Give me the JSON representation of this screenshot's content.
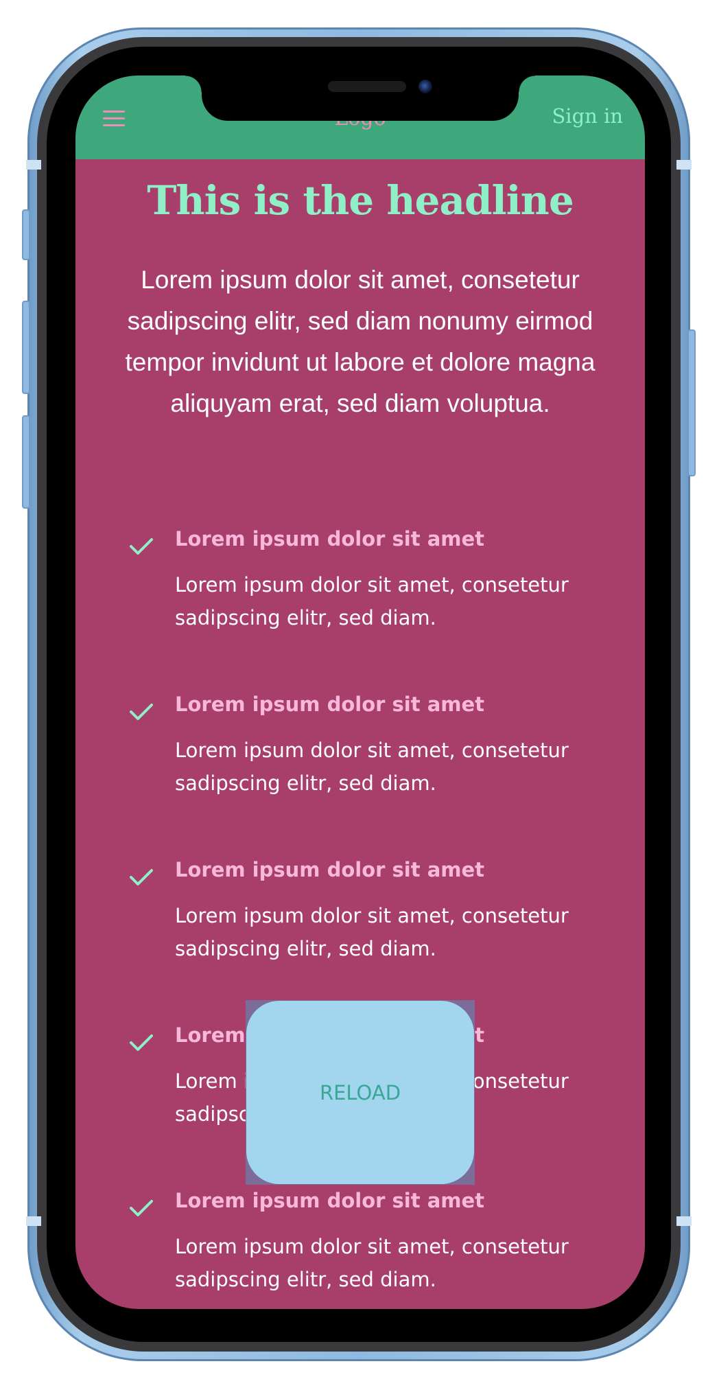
{
  "header": {
    "logo": "Logo",
    "sign_in": "Sign in"
  },
  "hero": {
    "headline": "This is the headline",
    "intro": "Lorem ipsum dolor sit amet, consetetur sadipscing elitr, sed diam nonumy eirmod tempor invidunt ut labore et dolore magna aliquyam erat, sed diam voluptua."
  },
  "features": [
    {
      "title": "Lorem ipsum dolor sit amet",
      "text": "Lorem ipsum dolor sit amet, consetetur sadipscing elitr, sed diam."
    },
    {
      "title": "Lorem ipsum dolor sit amet",
      "text": "Lorem ipsum dolor sit amet, consetetur sadipscing elitr, sed diam."
    },
    {
      "title": "Lorem ipsum dolor sit amet",
      "text": "Lorem ipsum dolor sit amet, consetetur sadipscing elitr, sed diam."
    },
    {
      "title": "Lorem ipsum dolor sit amet",
      "text": "Lorem ipsum dolor sit amet, consetetur sadipscing elitr, sed diam."
    },
    {
      "title": "Lorem ipsum dolor sit amet",
      "text": "Lorem ipsum dolor sit amet, consetetur sadipscing elitr, sed diam."
    }
  ],
  "overlay": {
    "reload_label": "RELOAD"
  },
  "icons": {
    "menu": "hamburger-menu-icon",
    "check": "check-icon"
  },
  "colors": {
    "header_bg": "#3ea77c",
    "page_bg": "#a83e6a",
    "headline": "#8ff0c8",
    "feature_title": "#f7b8dc",
    "accent_pink": "#ec8fb6",
    "reload_bg": "#a2d6ef",
    "reload_text": "#3aa696",
    "phone_frame": "#8fb9e0"
  }
}
